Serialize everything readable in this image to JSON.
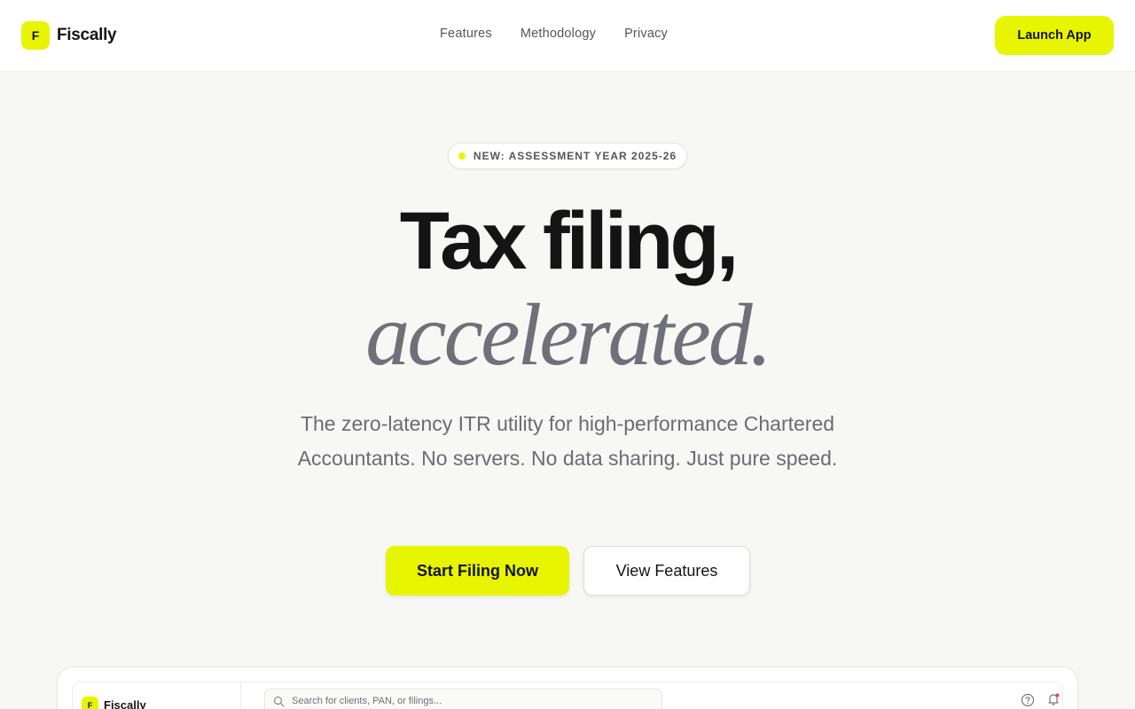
{
  "header": {
    "brand_mark": "F",
    "brand_name": "Fiscally",
    "nav": [
      "Features",
      "Methodology",
      "Privacy"
    ],
    "launch_label": "Launch App"
  },
  "hero": {
    "badge": "NEW: ASSESSMENT YEAR 2025-26",
    "title_line1": "Tax filing,",
    "title_line2": "accelerated.",
    "subtitle": "The zero-latency ITR utility for high-performance Chartered Accountants. No servers. No data sharing. Just pure speed.",
    "primary_cta": "Start Filing Now",
    "secondary_cta": "View Features"
  },
  "preview": {
    "brand_mark": "F",
    "brand_name": "Fiscally",
    "search_placeholder": "Search for clients, PAN, or filings...",
    "icons": [
      "search-icon",
      "help-icon",
      "bell-icon"
    ]
  },
  "colors": {
    "accent": "#e8f500",
    "background": "#f7f7f5",
    "text": "#141414",
    "muted": "#6b6c72"
  }
}
